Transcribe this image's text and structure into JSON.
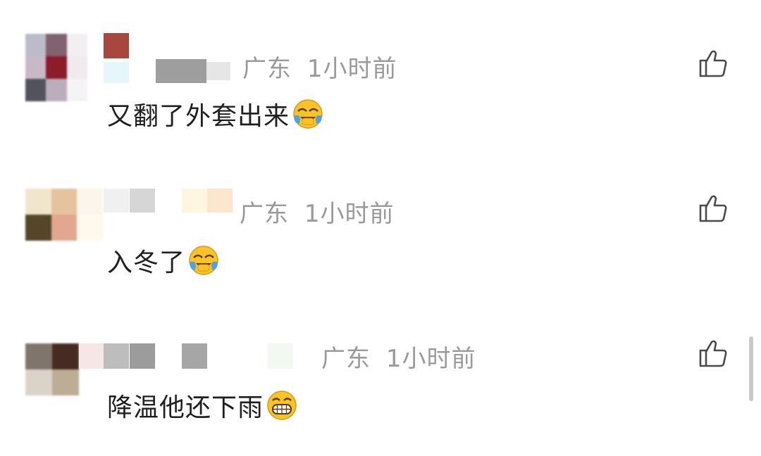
{
  "comments": [
    {
      "location": "广东",
      "time": "1小时前",
      "text": "又翻了外套出来",
      "emoji": "laughing-crying-emoji"
    },
    {
      "location": "广东",
      "time": "1小时前",
      "text": "入冬了",
      "emoji": "laughing-crying-emoji"
    },
    {
      "location": "广东",
      "time": "1小时前",
      "text": "降温他还下雨",
      "emoji": "grinning-emoji"
    }
  ],
  "icons": {
    "like": "thumbs-up-icon"
  }
}
